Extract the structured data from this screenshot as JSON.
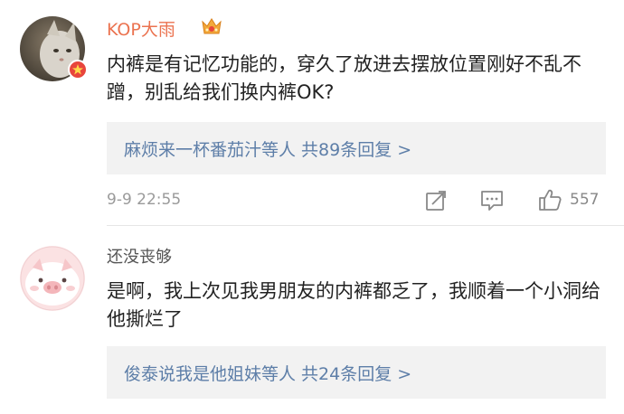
{
  "comments": [
    {
      "username": "KOP大雨",
      "text": "内裤是有记忆功能的，穿久了放进去摆放位置刚好不乱不蹭，别乱给我们换内裤OK?",
      "replies": {
        "name": "麻烦来一杯番茄汁",
        "suffix": "等人  共89条回复 >"
      },
      "time": "9-9 22:55",
      "likes": "557"
    },
    {
      "username": "还没丧够",
      "text": "是啊，我上次见我男朋友的内裤都乏了，我顺着一个小洞给他撕烂了",
      "replies": {
        "name": "俊泰说我是他姐妹",
        "suffix": "等人  共24条回复 >"
      }
    }
  ],
  "colors": {
    "accent": "#eb7350",
    "link": "#5d7ea8",
    "reply_bg": "#f2f2f2",
    "badge": "#e8453c"
  },
  "icons": [
    "cat-avatar",
    "verified-badge-icon",
    "crown-badge-icon",
    "repost-icon",
    "comment-icon",
    "like-icon",
    "pig-avatar"
  ]
}
